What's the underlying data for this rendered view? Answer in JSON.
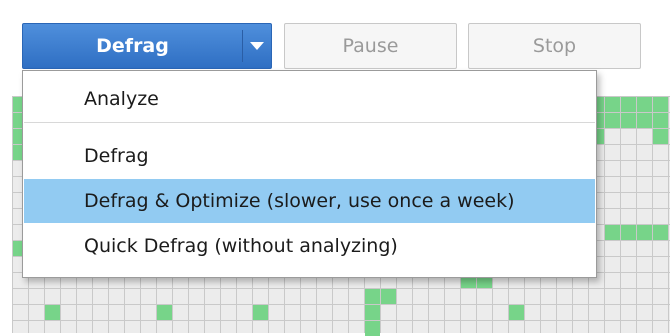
{
  "toolbar": {
    "defrag_label": "Defrag",
    "pause_label": "Pause",
    "stop_label": "Stop"
  },
  "menu": {
    "items": [
      {
        "label": "Analyze"
      },
      {
        "label": "Defrag"
      },
      {
        "label": "Defrag & Optimize (slower, use once a week)",
        "highlighted": true
      },
      {
        "label": "Quick Defrag (without analyzing)"
      }
    ]
  },
  "colors": {
    "accent": "#2f6fc3",
    "highlight": "#92cbf2",
    "block_used": "#77d489",
    "block_empty": "#ececec"
  }
}
